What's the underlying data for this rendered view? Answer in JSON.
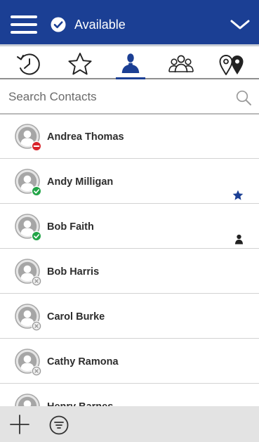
{
  "header": {
    "menu_icon": "hamburger-menu-icon",
    "status_label": "Available",
    "status_icon": "checkmark-circle-icon",
    "expand_icon": "chevron-down-icon",
    "bar_color": "#1b3f94"
  },
  "tabs": [
    {
      "id": "recent",
      "icon": "history-clock-icon",
      "active": false
    },
    {
      "id": "favorites",
      "icon": "star-outline-icon",
      "active": false
    },
    {
      "id": "contacts",
      "icon": "person-icon",
      "active": true
    },
    {
      "id": "groups",
      "icon": "group-icon",
      "active": false
    },
    {
      "id": "locations",
      "icon": "location-pins-icon",
      "active": false
    }
  ],
  "search": {
    "placeholder": "Search Contacts",
    "value": ""
  },
  "contacts": [
    {
      "name": "Andrea Thomas",
      "presence": "busy",
      "tag": null
    },
    {
      "name": "Andy Milligan",
      "presence": "available",
      "tag": "favorite-star-icon"
    },
    {
      "name": "Bob Faith",
      "presence": "available",
      "tag": "person-icon"
    },
    {
      "name": "Bob Harris",
      "presence": "offline",
      "tag": null
    },
    {
      "name": "Carol Burke",
      "presence": "offline",
      "tag": null
    },
    {
      "name": "Cathy Ramona",
      "presence": "offline",
      "tag": null
    },
    {
      "name": "Henry Barnes",
      "presence": "offline",
      "tag": null
    }
  ],
  "presence_colors": {
    "available": "#22a447",
    "busy": "#d8232a",
    "offline": "#9a9a9a"
  },
  "footer": {
    "add_icon": "plus-icon",
    "filter_icon": "filter-icon"
  }
}
